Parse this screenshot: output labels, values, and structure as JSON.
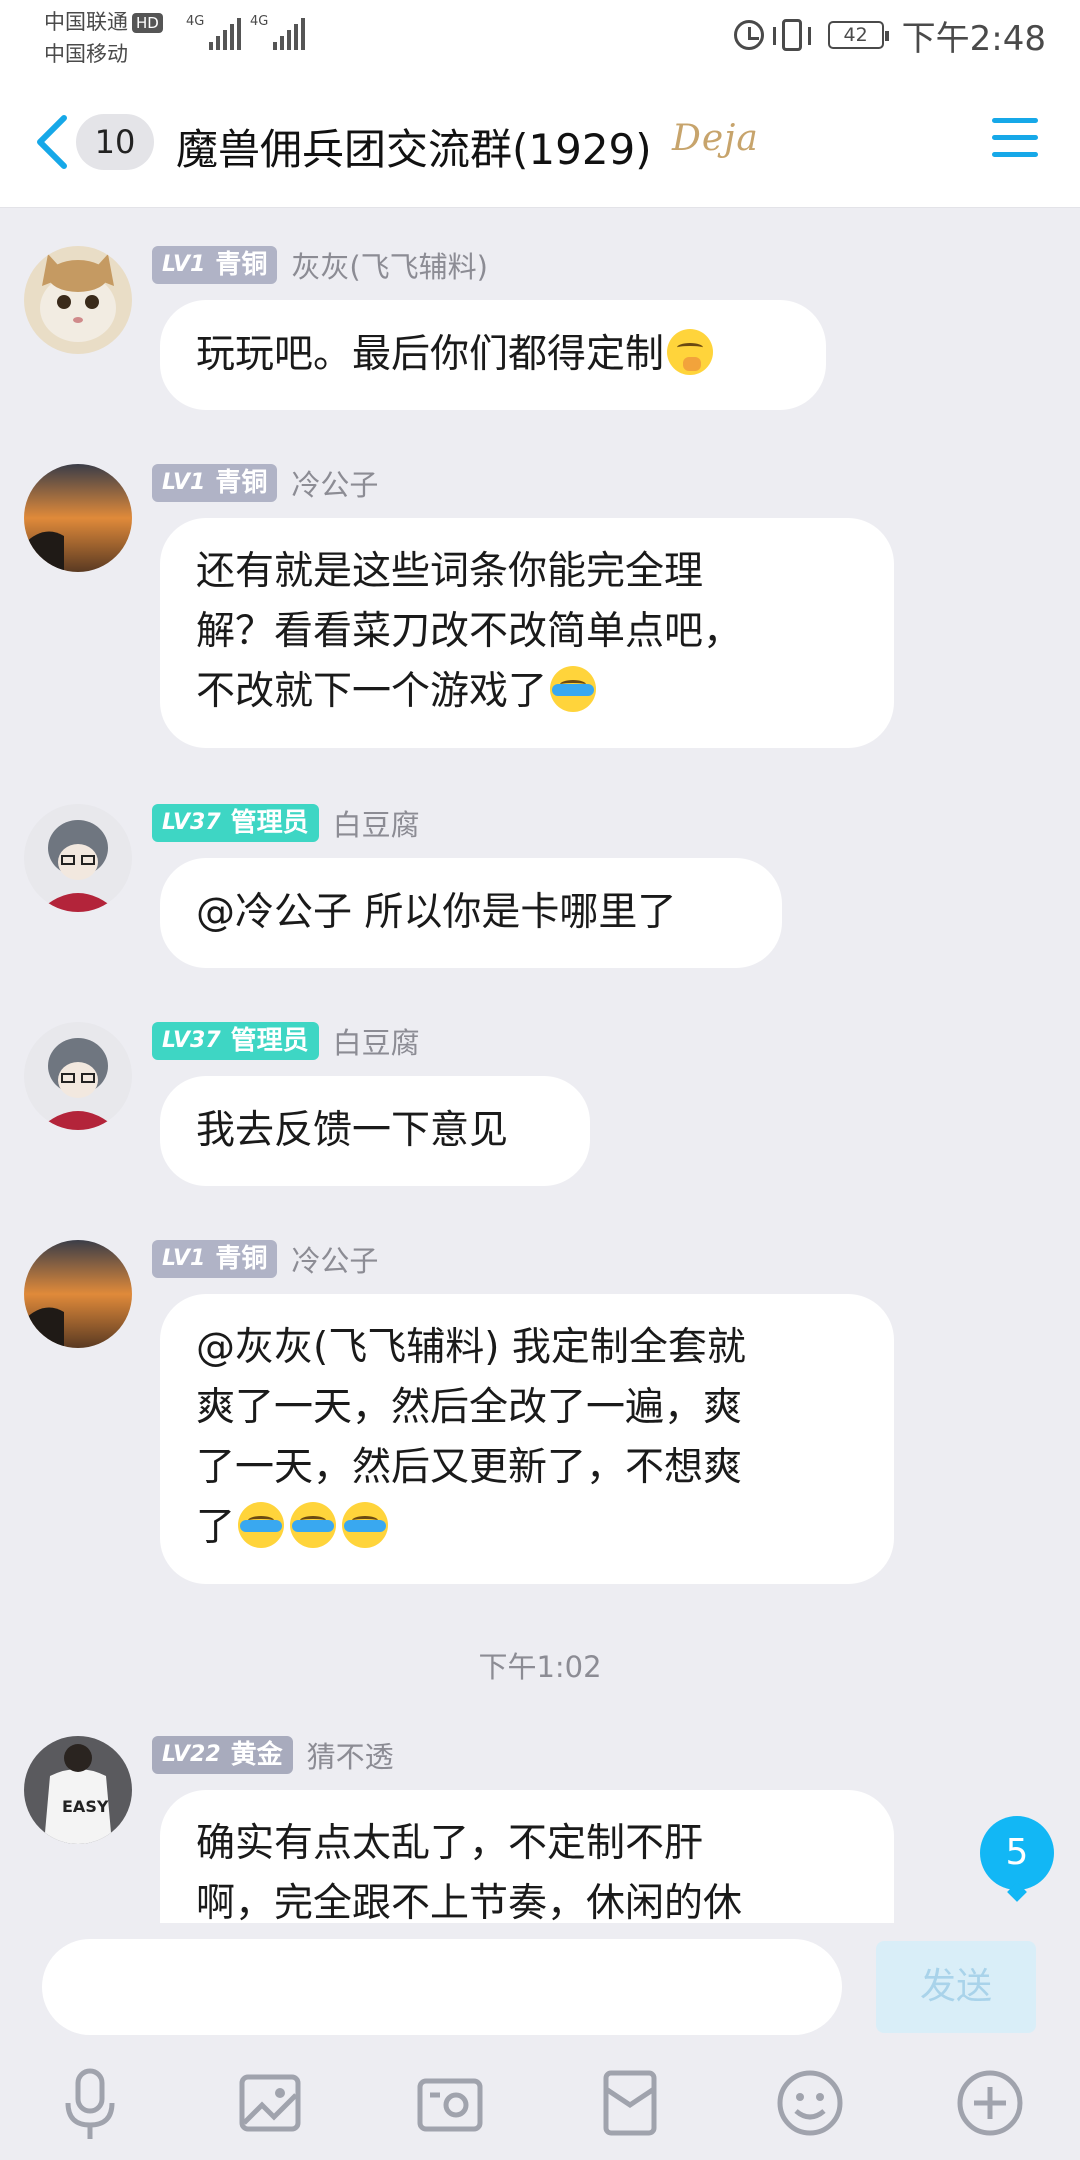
{
  "status": {
    "carrier1": "中国联通",
    "hd": "HD",
    "carrier2": "中国移动",
    "network1": "4G",
    "network2": "4G",
    "battery": "42",
    "time": "下午2:48"
  },
  "header": {
    "unread": "10",
    "title": "魔兽佣兵团交流群(1929)",
    "badge": "Deja"
  },
  "messages": [
    {
      "level": "LV1",
      "rank": "青铜",
      "sender": "灰灰(飞飞辅料)",
      "lines": [
        "玩玩吧。最后你们都得定制"
      ],
      "emoji": "smirk"
    },
    {
      "level": "LV1",
      "rank": "青铜",
      "sender": "冷公子",
      "lines": [
        "还有就是这些词条你能完全理",
        "解？看看菜刀改不改简单点吧，",
        "不改就下一个游戏了"
      ],
      "emoji": "cry"
    },
    {
      "level": "LV37",
      "rank": "管理员",
      "sender": "白豆腐",
      "lines": [
        "@冷公子 所以你是卡哪里了"
      ]
    },
    {
      "level": "LV37",
      "rank": "管理员",
      "sender": "白豆腐",
      "lines": [
        "我去反馈一下意见"
      ]
    },
    {
      "level": "LV1",
      "rank": "青铜",
      "sender": "冷公子",
      "lines": [
        "@灰灰(飞飞辅料) 我定制全套就",
        "爽了一天，然后全改了一遍，爽",
        "了一天，然后又更新了，不想爽",
        "了"
      ],
      "emoji": "cry3"
    },
    {
      "level": "LV22",
      "rank": "黄金",
      "sender": "猜不透",
      "lines": [
        "确实有点太乱了，不定制不肝",
        "啊，完全跟不上节奏，休闲的休"
      ]
    }
  ],
  "timestamp": "下午1:02",
  "new_message_count": "5",
  "input": {
    "placeholder": "",
    "send_label": "发送"
  },
  "toolbar": [
    "mic-icon",
    "image-icon",
    "camera-icon",
    "red-packet-icon",
    "emoji-icon",
    "plus-icon"
  ],
  "colors": {
    "accent": "#12b7f5",
    "bronze_badge": "#b0b3c6",
    "admin_badge": "#3ed6c4",
    "gold_badge": "#a8abbd"
  }
}
